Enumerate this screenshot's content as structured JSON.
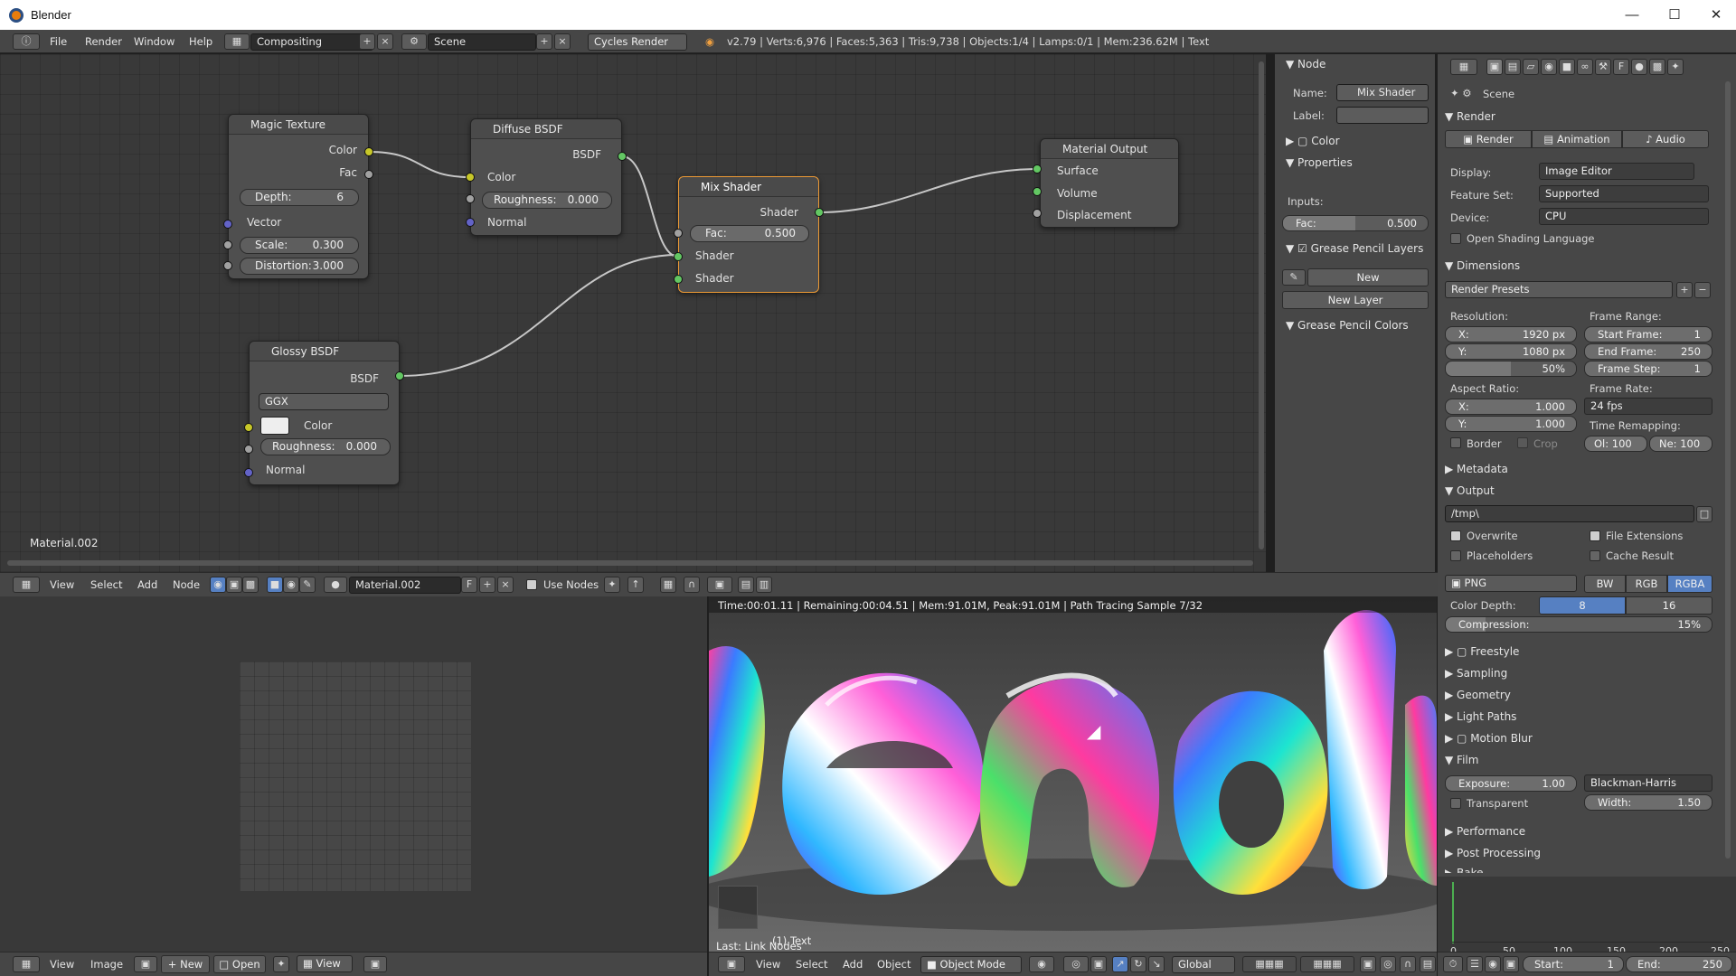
{
  "window": {
    "title": "Blender"
  },
  "menubar": {
    "file": "File",
    "render": "Render",
    "window": "Window",
    "help": "Help",
    "screen": "Compositing",
    "scene": "Scene",
    "engine": "Cycles Render",
    "stats": "v2.79 | Verts:6,976 | Faces:5,363 | Tris:9,738 | Objects:1/4 | Lamps:0/1 | Mem:236.62M | Text"
  },
  "nodes": {
    "magic": {
      "title": "Magic Texture",
      "out_color": "Color",
      "out_fac": "Fac",
      "depth_label": "Depth:",
      "depth": "6",
      "vector": "Vector",
      "scale_label": "Scale:",
      "scale": "0.300",
      "distortion_label": "Distortion:",
      "distortion": "3.000"
    },
    "diffuse": {
      "title": "Diffuse BSDF",
      "out": "BSDF",
      "color": "Color",
      "roughness_label": "Roughness:",
      "roughness": "0.000",
      "normal": "Normal"
    },
    "glossy": {
      "title": "Glossy BSDF",
      "out": "BSDF",
      "distribution": "GGX",
      "color": "Color",
      "roughness_label": "Roughness:",
      "roughness": "0.000",
      "normal": "Normal"
    },
    "mix": {
      "title": "Mix Shader",
      "out": "Shader",
      "fac_label": "Fac:",
      "fac": "0.500",
      "shader1": "Shader",
      "shader2": "Shader"
    },
    "output": {
      "title": "Material Output",
      "surface": "Surface",
      "volume": "Volume",
      "displacement": "Displacement"
    }
  },
  "node_editor": {
    "material_label": "Material.002",
    "header": {
      "view": "View",
      "select": "Select",
      "add": "Add",
      "node": "Node",
      "material": "Material.002",
      "fake": "F",
      "use_nodes": "Use Nodes"
    }
  },
  "sidebar": {
    "node_section": "Node",
    "name_label": "Name:",
    "name": "Mix Shader",
    "label_label": "Label:",
    "color": "Color",
    "properties": "Properties",
    "inputs": "Inputs:",
    "fac_label": "Fac:",
    "fac": "0.500",
    "gp_layers": "Grease Pencil Layers",
    "new": "New",
    "new_layer": "New Layer",
    "gp_colors": "Grease Pencil Colors"
  },
  "props": {
    "scene": "Scene",
    "render_section": "Render",
    "render_btn": "Render",
    "animation_btn": "Animation",
    "audio_btn": "Audio",
    "display_label": "Display:",
    "display": "Image Editor",
    "feature_label": "Feature Set:",
    "feature": "Supported",
    "device_label": "Device:",
    "device": "CPU",
    "osl": "Open Shading Language",
    "dimensions": "Dimensions",
    "render_presets": "Render Presets",
    "resolution": "Resolution:",
    "res_x": "X:",
    "res_x_val": "1920 px",
    "res_y": "Y:",
    "res_y_val": "1080 px",
    "res_pct": "50%",
    "frame_range": "Frame Range:",
    "start_frame": "Start Frame:",
    "start_val": "1",
    "end_frame": "End Frame:",
    "end_val": "250",
    "frame_step": "Frame Step:",
    "step_val": "1",
    "aspect": "Aspect Ratio:",
    "asp_x": "X:",
    "asp_x_val": "1.000",
    "asp_y": "Y:",
    "asp_y_val": "1.000",
    "frame_rate": "Frame Rate:",
    "fps": "24 fps",
    "time_remap": "Time Remapping:",
    "old": "Ol: 100",
    "new": "Ne: 100",
    "border": "Border",
    "crop": "Crop",
    "metadata": "Metadata",
    "output": "Output",
    "path": "/tmp\\",
    "overwrite": "Overwrite",
    "file_ext": "File Extensions",
    "placeholders": "Placeholders",
    "cache": "Cache Result",
    "format": "PNG",
    "bw": "BW",
    "rgb": "RGB",
    "rgba": "RGBA",
    "color_depth": "Color Depth:",
    "depth8": "8",
    "depth16": "16",
    "compression": "Compression:",
    "compression_val": "15%",
    "freestyle": "Freestyle",
    "sampling": "Sampling",
    "geometry": "Geometry",
    "light_paths": "Light Paths",
    "motion_blur": "Motion Blur",
    "film": "Film",
    "exposure": "Exposure:",
    "exposure_val": "1.00",
    "filter": "Blackman-Harris",
    "transparent": "Transparent",
    "width": "Width:",
    "width_val": "1.50",
    "performance": "Performance",
    "post": "Post Processing",
    "bake": "Bake"
  },
  "image_editor": {
    "view": "View",
    "image": "Image",
    "new": "New",
    "open": "Open",
    "view2": "View"
  },
  "render_view": {
    "status": "Time:00:01.11 | Remaining:00:04.51 | Mem:91.01M, Peak:91.01M | Path Tracing Sample 7/32",
    "last_op": "Last: Link Nodes",
    "obj_label": "(1) Text",
    "view": "View",
    "select": "Select",
    "add": "Add",
    "object": "Object",
    "mode": "Object Mode",
    "orientation": "Global"
  },
  "timeline": {
    "ticks": [
      "0",
      "50",
      "100",
      "150",
      "200",
      "250"
    ],
    "start": "Start:",
    "start_val": "1",
    "end": "End:",
    "end_val": "250"
  }
}
